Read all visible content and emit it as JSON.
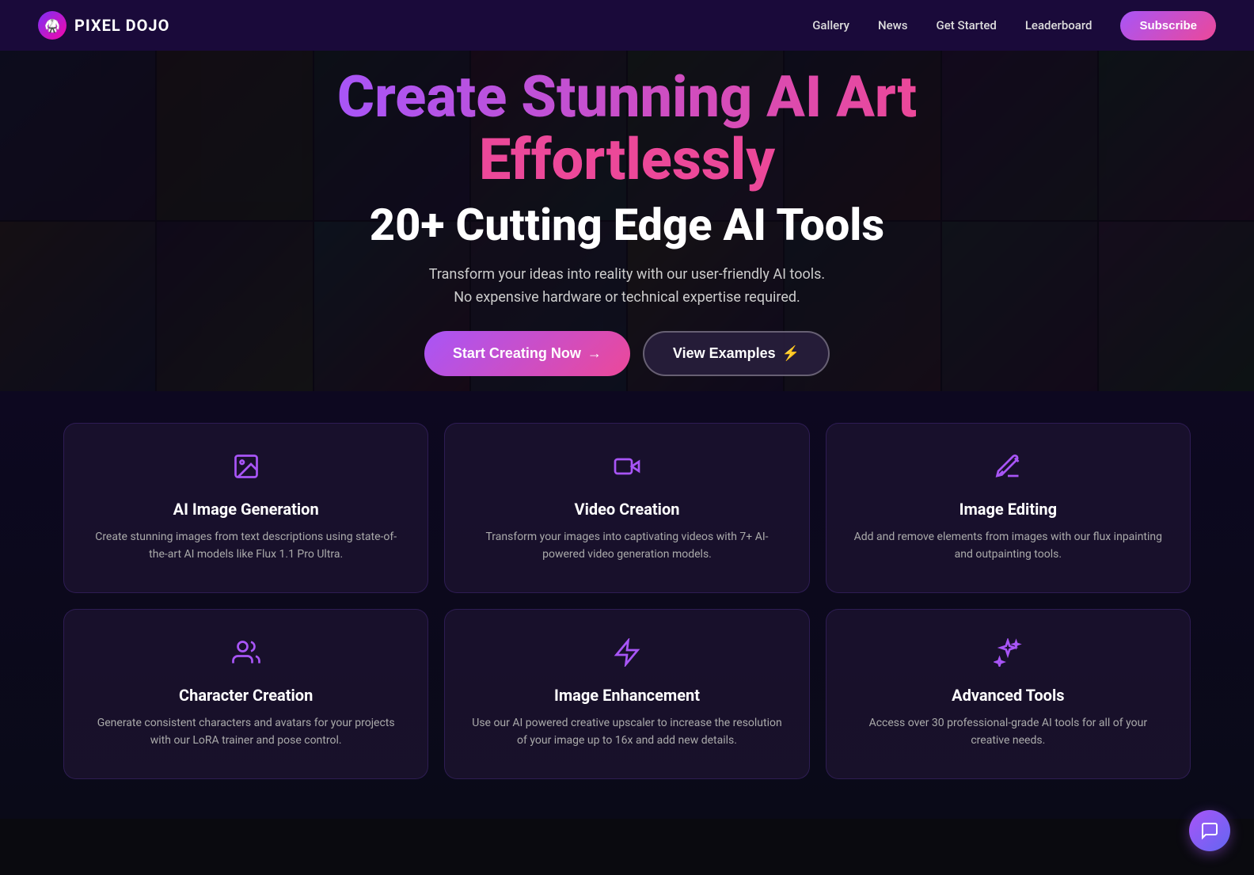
{
  "navbar": {
    "logo_icon": "🥋",
    "logo_text": "PIXEL DOJO",
    "links": [
      {
        "id": "gallery",
        "label": "Gallery"
      },
      {
        "id": "news",
        "label": "News"
      },
      {
        "id": "get-started",
        "label": "Get Started"
      },
      {
        "id": "leaderboard",
        "label": "Leaderboard"
      }
    ],
    "subscribe_label": "Subscribe"
  },
  "hero": {
    "title_line1": "Create Stunning AI Art",
    "title_line2": "Effortlessly",
    "subtitle": "20+ Cutting Edge AI Tools",
    "description_line1": "Transform your ideas into reality with our user-friendly AI tools.",
    "description_line2": "No expensive hardware or technical expertise required.",
    "btn_primary": "Start Creating Now",
    "btn_secondary": "View Examples"
  },
  "features": [
    {
      "id": "ai-image-generation",
      "icon_type": "image",
      "title": "AI Image Generation",
      "desc": "Create stunning images from text descriptions using state-of-the-art AI models like Flux 1.1 Pro Ultra."
    },
    {
      "id": "video-creation",
      "icon_type": "video",
      "title": "Video Creation",
      "desc": "Transform your images into captivating videos with 7+ AI-powered video generation models."
    },
    {
      "id": "image-editing",
      "icon_type": "edit",
      "title": "Image Editing",
      "desc": "Add and remove elements from images with our flux inpainting and outpainting tools."
    },
    {
      "id": "character-creation",
      "icon_type": "users",
      "title": "Character Creation",
      "desc": "Generate consistent characters and avatars for your projects with our LoRA trainer and pose control."
    },
    {
      "id": "image-enhancement",
      "icon_type": "zap",
      "title": "Image Enhancement",
      "desc": "Use our AI powered creative upscaler to increase the resolution of your image up to 16x and add new details."
    },
    {
      "id": "advanced-tools",
      "icon_type": "sparkles",
      "title": "Advanced Tools",
      "desc": "Access over 30 professional-grade AI tools for all of your creative needs."
    }
  ],
  "chat": {
    "icon": "💬"
  }
}
